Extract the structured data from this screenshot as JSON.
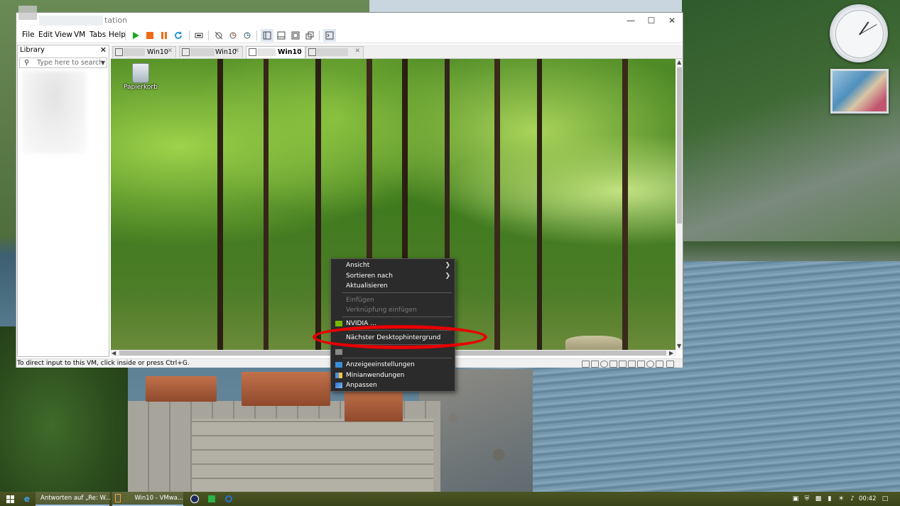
{
  "vmware": {
    "title_suffix": "tation",
    "menu": [
      "File",
      "Edit",
      "View",
      "VM",
      "Tabs",
      "Help"
    ],
    "library": {
      "title": "Library",
      "search_placeholder": "Type here to search"
    },
    "tabs": [
      {
        "label": "Win10",
        "active": false
      },
      {
        "label": "Win10",
        "active": false
      },
      {
        "label": "Win10",
        "active": true
      },
      {
        "label": "",
        "active": false
      }
    ],
    "status_text": "To direct input to this VM, click inside or press Ctrl+G."
  },
  "guest_desktop": {
    "recycle_bin_label": "Papierkorb"
  },
  "context_menu": {
    "items": [
      {
        "label": "Ansicht",
        "submenu": true,
        "disabled": false
      },
      {
        "label": "Sortieren nach",
        "submenu": true,
        "disabled": false
      },
      {
        "label": "Aktualisieren",
        "submenu": false,
        "disabled": false
      },
      {
        "label": "Einfügen",
        "submenu": false,
        "disabled": true
      },
      {
        "label": "Verknüpfung einfügen",
        "submenu": false,
        "disabled": true
      },
      {
        "label": "NVIDIA ...",
        "submenu": false,
        "disabled": false
      },
      {
        "label": "Nächster Desktophintergrund",
        "submenu": false,
        "disabled": false
      },
      {
        "label": "Anzeigeeinstellungen",
        "submenu": false,
        "disabled": false
      },
      {
        "label": "Minianwendungen",
        "submenu": false,
        "disabled": false
      },
      {
        "label": "Anpassen",
        "submenu": false,
        "disabled": false
      }
    ]
  },
  "taskbar": {
    "items": [
      {
        "label": "Antworten auf „Re: W...",
        "icon": "firefox-icon"
      },
      {
        "label": "Win10 - VMwa...",
        "icon": "vmware-icon"
      }
    ],
    "clock": "00:42"
  },
  "colors": {
    "highlight": "#e80000",
    "menu_bg": "#2b2b2b",
    "taskbar": "#3f4a1e"
  }
}
